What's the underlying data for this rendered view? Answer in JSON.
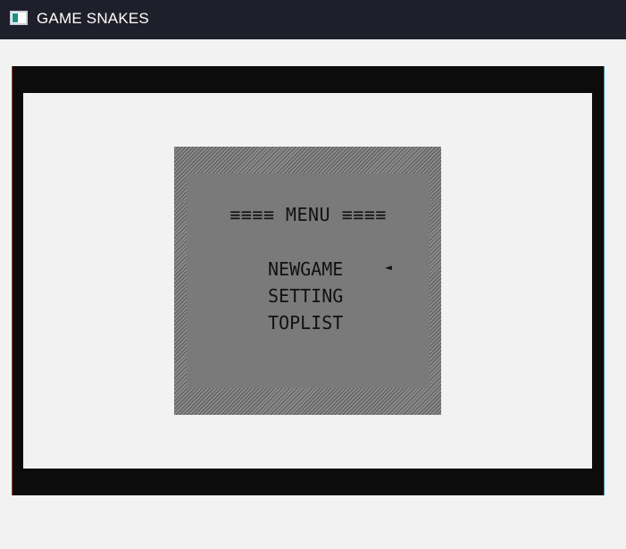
{
  "window": {
    "title": "GAME SNAKES",
    "icon": "console-window-icon"
  },
  "menu": {
    "title": "≡≡≡≡ MENU ≡≡≡≡",
    "items": [
      {
        "label": "NEWGAME",
        "selected": true
      },
      {
        "label": "SETTING",
        "selected": false
      },
      {
        "label": "TOPLIST",
        "selected": false
      }
    ],
    "selector_glyph": "◄"
  },
  "colors": {
    "titlebar_bg": "#1f1f2b",
    "console_bg": "#0c0c0c",
    "screen_bg": "#f2f2f2",
    "menu_panel": "#7a7a7a",
    "menu_text": "#111111"
  }
}
